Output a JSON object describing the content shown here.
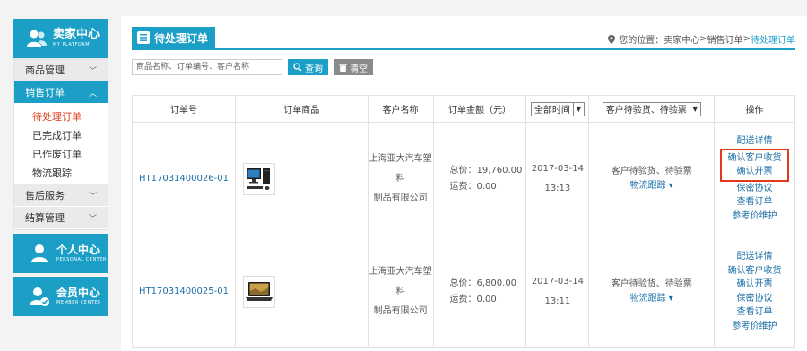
{
  "sidebar": {
    "header": {
      "title": "卖家中心",
      "subtitle": "MY PLATFORM"
    },
    "groups": [
      {
        "label": "商品管理"
      },
      {
        "label": "销售订单"
      },
      {
        "label": "售后服务"
      },
      {
        "label": "结算管理"
      }
    ],
    "sales_items": [
      {
        "label": "待处理订单"
      },
      {
        "label": "已完成订单"
      },
      {
        "label": "已作废订单"
      },
      {
        "label": "物流跟踪"
      }
    ],
    "personal": {
      "title": "个人中心",
      "subtitle": "PERSONAL CENTER"
    },
    "member": {
      "title": "会员中心",
      "subtitle": "MEMBER CENTER"
    }
  },
  "header": {
    "title": "待处理订单",
    "breadcrumb": {
      "prefix": "您的位置：",
      "home": "卖家中心",
      "sep1": " > ",
      "section": "销售订单",
      "sep2": " > ",
      "current": "待处理订单"
    }
  },
  "search": {
    "placeholder": "商品名称、订单编号、客户名称",
    "search_label": "查询",
    "clear_label": "清空"
  },
  "table": {
    "headers": {
      "order_no": "订单号",
      "product": "订单商品",
      "customer": "客户名称",
      "amount": "订单金额（元）",
      "time_filter": "全部时间",
      "status_filter": "客户待验货、待验票",
      "actions": "操作"
    },
    "rows": [
      {
        "order_no": "HT17031400026-01",
        "customer_line1": "上海亚大汽车塑料",
        "customer_line2": "制品有限公司",
        "total": "总价：19,760.00",
        "freight": "运费：0.00",
        "date": "2017-03-14",
        "time": "13:13",
        "status": "客户待验货、待验票",
        "track": "物流跟踪",
        "actions": [
          "配送详情",
          "确认客户收货",
          "确认开票",
          "保密协议",
          "查看订单",
          "参考价维护"
        ]
      },
      {
        "order_no": "HT17031400025-01",
        "customer_line1": "上海亚大汽车塑料",
        "customer_line2": "制品有限公司",
        "total": "总价：6,800.00",
        "freight": "运费：0.00",
        "date": "2017-03-14",
        "time": "13:11",
        "status": "客户待验货、待验票",
        "track": "物流跟踪",
        "actions": [
          "配送详情",
          "确认客户收货",
          "确认开票",
          "保密协议",
          "查看订单",
          "参考价维护"
        ]
      }
    ]
  },
  "colors": {
    "accent": "#1b9fc7",
    "alert": "#e03a1b",
    "link": "#1b6fa8"
  }
}
